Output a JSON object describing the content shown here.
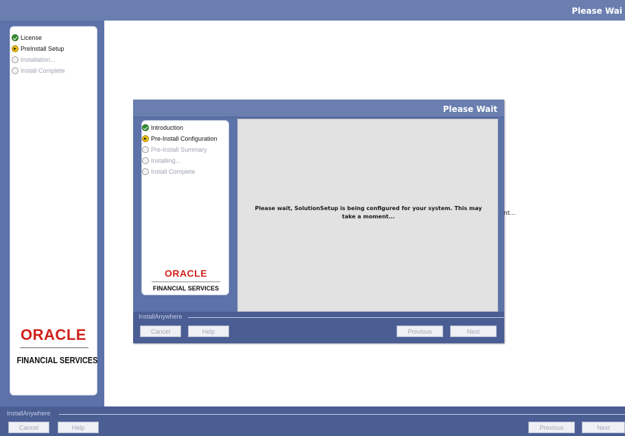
{
  "outer": {
    "title": "Please Wai",
    "steps": [
      {
        "label": "License",
        "state": "done"
      },
      {
        "label": "PreInstall Setup",
        "state": "current"
      },
      {
        "label": "Installation...",
        "state": "todo"
      },
      {
        "label": "Install Complete",
        "state": "todo"
      }
    ],
    "logo_text": "ORACLE",
    "logo_subtitle": "FINANCIAL SERVICES",
    "footer_label": "InstallAnywhere",
    "buttons": {
      "cancel": "Cancel",
      "help": "Help",
      "previous": "Previous",
      "next": "Next"
    },
    "partial_text": "nt..."
  },
  "dialog": {
    "title": "Please Wait",
    "steps": [
      {
        "label": "Introduction",
        "state": "done"
      },
      {
        "label": "Pre-Install Configuration",
        "state": "current"
      },
      {
        "label": "Pre-Install Summary",
        "state": "todo"
      },
      {
        "label": "Installing...",
        "state": "todo"
      },
      {
        "label": "Install Complete",
        "state": "todo"
      }
    ],
    "logo_text": "ORACLE",
    "logo_subtitle": "FINANCIAL SERVICES",
    "message_line1": "Please wait, SolutionSetup is being configured for your system.  This may",
    "message_line2": "take a moment...",
    "footer_label": "InstallAnywhere",
    "buttons": {
      "cancel": "Cancel",
      "help": "Help",
      "previous": "Previous",
      "next": "Next"
    }
  },
  "colors": {
    "window_blue": "#5c72a8",
    "header_blue": "#6a7fb0",
    "footer_blue": "#4a5e94",
    "oracle_red": "#d0201a",
    "step_done": "#2f8f2f",
    "step_current": "#f0c419"
  }
}
